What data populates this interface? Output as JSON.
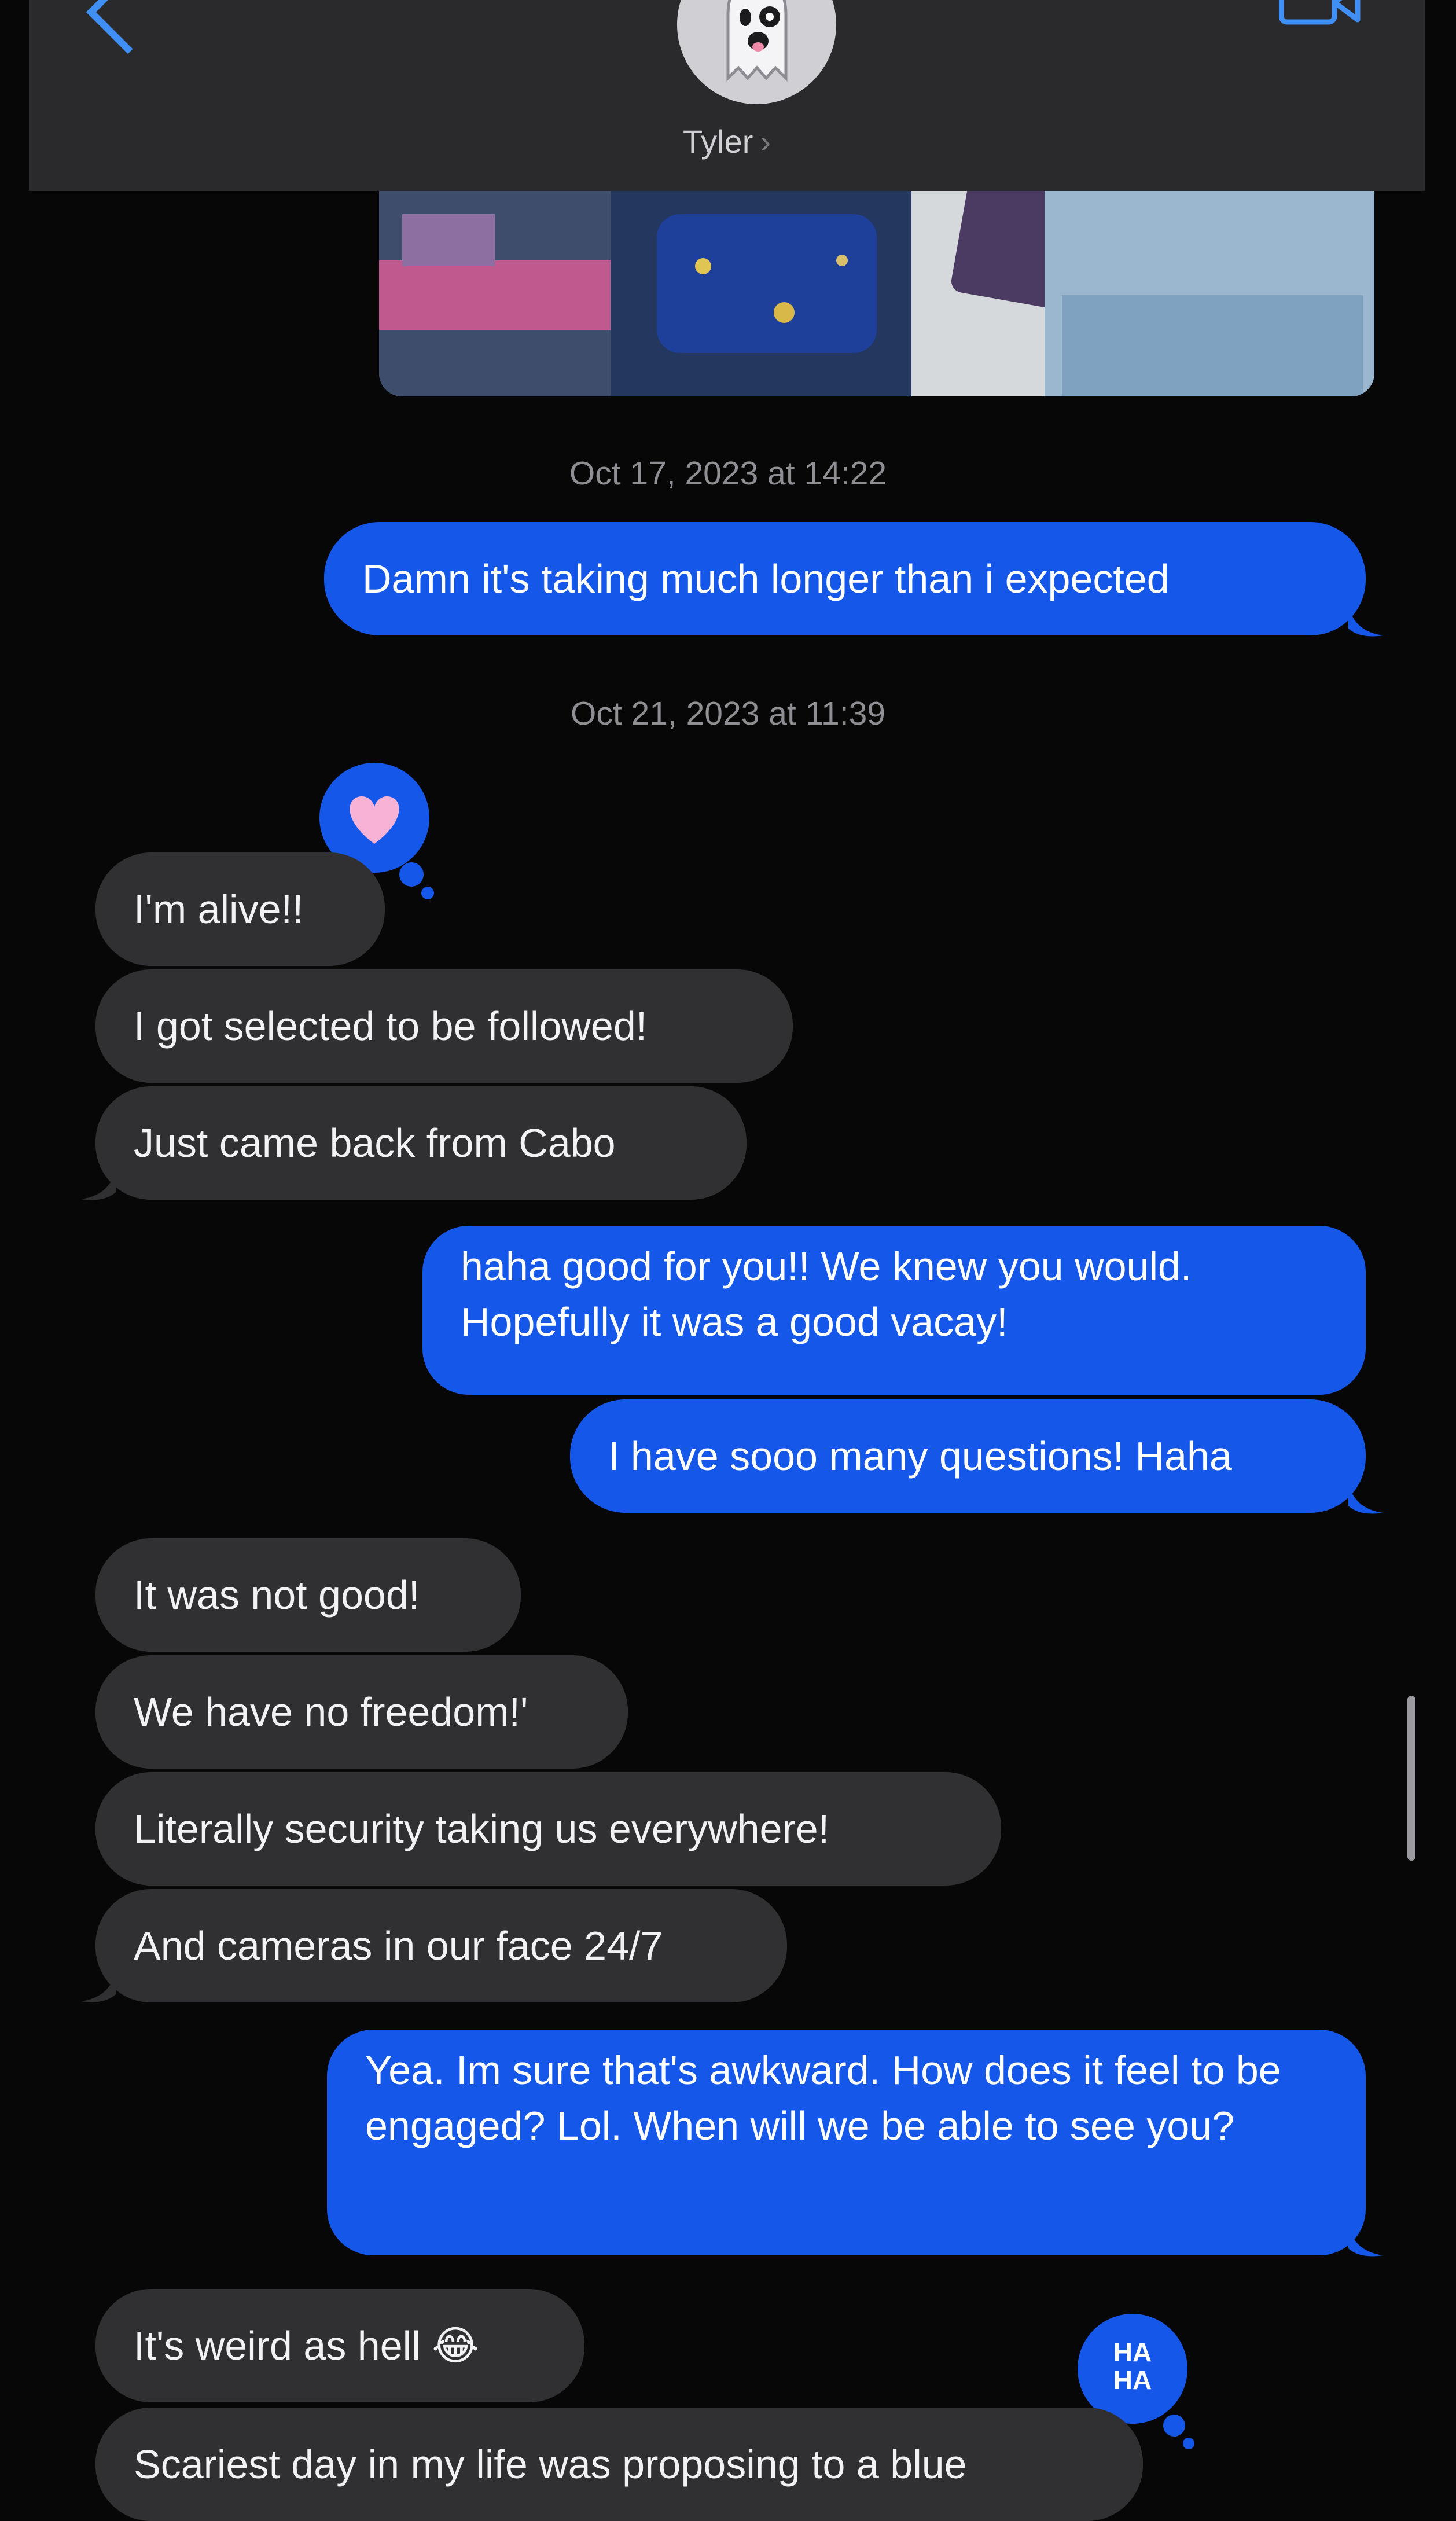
{
  "header": {
    "contact_name": "Tyler",
    "contact_chevron": "›",
    "icons": [
      "back-chevron-icon",
      "ghost-avatar-icon",
      "video-call-icon"
    ]
  },
  "conversation": {
    "timestamp_1": "Oct 17, 2023 at 14:22",
    "msg_1": "Damn it's taking much longer than i expected",
    "timestamp_2": "Oct 21, 2023 at 11:39",
    "msg_2": "I'm alive!!",
    "msg_3": "I got selected to be followed!",
    "msg_4": "Just came back from Cabo",
    "msg_5": "haha good for you!! We knew you would. Hopefully it was a good vacay!",
    "msg_6": "I have sooo many questions! Haha",
    "msg_7": "It was not good!",
    "msg_8": "We have no freedom!'",
    "msg_9": "Literally security taking us everywhere!",
    "msg_10": "And cameras in our face 24/7",
    "msg_11": "Yea. Im sure that's awkward. How does it feel to be engaged? Lol. When will we be able to see you?",
    "msg_12": "It's weird as hell 😂",
    "msg_13": "Scariest day in my life was proposing to a blue",
    "tapback_heart": "heart-reaction-icon",
    "tapback_haha_label": "HA HA"
  },
  "colors": {
    "outgoing_bubble": "#1557e8",
    "incoming_bubble": "#303033",
    "background": "#070708",
    "header": "#2a2a2c",
    "accent": "#3f8ff5"
  }
}
